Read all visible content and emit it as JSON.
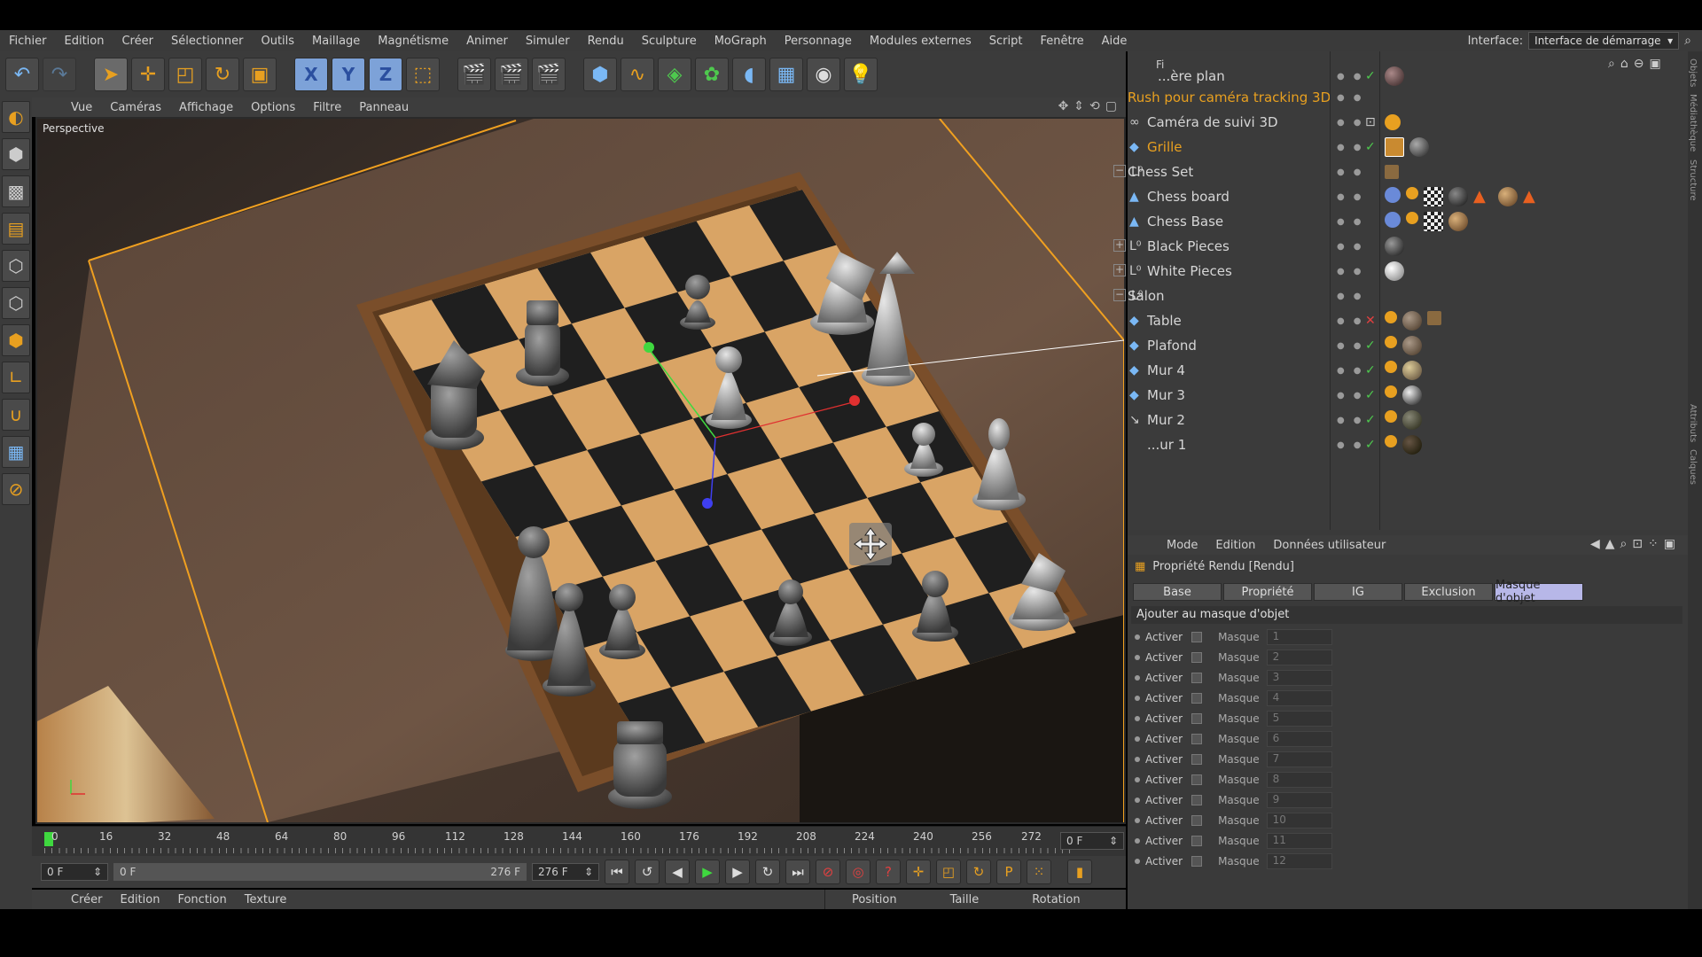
{
  "menu": {
    "items": [
      "Fichier",
      "Edition",
      "Créer",
      "Sélectionner",
      "Outils",
      "Maillage",
      "Magnétisme",
      "Animer",
      "Simuler",
      "Rendu",
      "Sculpture",
      "MoGraph",
      "Personnage",
      "Modules externes",
      "Script",
      "Fenêtre",
      "Aide"
    ],
    "interface_label": "Interface:",
    "interface_value": "Interface de démarrage"
  },
  "toolbar": {
    "axis_x": "X",
    "axis_y": "Y",
    "axis_z": "Z"
  },
  "viewport_menu": {
    "items": [
      "Vue",
      "Caméras",
      "Affichage",
      "Options",
      "Filtre",
      "Panneau"
    ],
    "label": "Perspective"
  },
  "timeline": {
    "ticks": [
      "0",
      "16",
      "32",
      "48",
      "64",
      "80",
      "96",
      "112",
      "128",
      "144",
      "160",
      "176",
      "192",
      "208",
      "224",
      "240",
      "256",
      "272"
    ],
    "current_frame": "0 F",
    "start_frame": "0 F",
    "range_start": "0 F",
    "range_end": "276 F",
    "end_frame": "276 F"
  },
  "bottom_menu": {
    "items": [
      "Créer",
      "Edition",
      "Fonction",
      "Texture"
    ],
    "coord_labels": [
      "Position",
      "Taille",
      "Rotation"
    ]
  },
  "objects": {
    "header_partial": "Fi",
    "rows": [
      {
        "name": "...ère plan",
        "indent": 0,
        "check": true
      },
      {
        "name": "Rush pour caméra tracking 3D",
        "indent": 0,
        "highlight": true
      },
      {
        "name": "Caméra de suivi 3D",
        "indent": 1
      },
      {
        "name": "Grille",
        "indent": 1,
        "check": true,
        "selected": true
      },
      {
        "name": "Chess Set",
        "indent": 0
      },
      {
        "name": "Chess board",
        "indent": 1
      },
      {
        "name": "Chess Base",
        "indent": 1
      },
      {
        "name": "Black Pieces",
        "indent": 1
      },
      {
        "name": "White Pieces",
        "indent": 1
      },
      {
        "name": "Salon",
        "indent": 0
      },
      {
        "name": "Table",
        "indent": 1,
        "check": false
      },
      {
        "name": "Plafond",
        "indent": 1,
        "check": true
      },
      {
        "name": "Mur 4",
        "indent": 1,
        "check": true
      },
      {
        "name": "Mur 3",
        "indent": 1,
        "check": true
      },
      {
        "name": "Mur 2",
        "indent": 1,
        "check": true
      },
      {
        "name": "...ur 1",
        "indent": 1,
        "check": true
      }
    ]
  },
  "attributes": {
    "menu": [
      "Mode",
      "Edition",
      "Données utilisateur"
    ],
    "title": "Propriété Rendu [Rendu]",
    "tabs": [
      "Base",
      "Propriété",
      "IG",
      "Exclusion",
      "Masque d'objet"
    ],
    "active_tab": "Masque d'objet",
    "section": "Ajouter au masque d'objet",
    "activer_label": "Activer",
    "masque_label": "Masque",
    "masks": [
      "1",
      "2",
      "3",
      "4",
      "5",
      "6",
      "7",
      "8",
      "9",
      "10",
      "11",
      "12"
    ]
  },
  "side_tabs": [
    "Objets",
    "Médiathèque",
    "Structure",
    "Attributs",
    "Calques"
  ],
  "colors": {
    "accent_orange": "#e8a020",
    "active_tab": "#b7b7e8",
    "check_green": "#4ec94e",
    "frame_orange": "#f0a020"
  }
}
